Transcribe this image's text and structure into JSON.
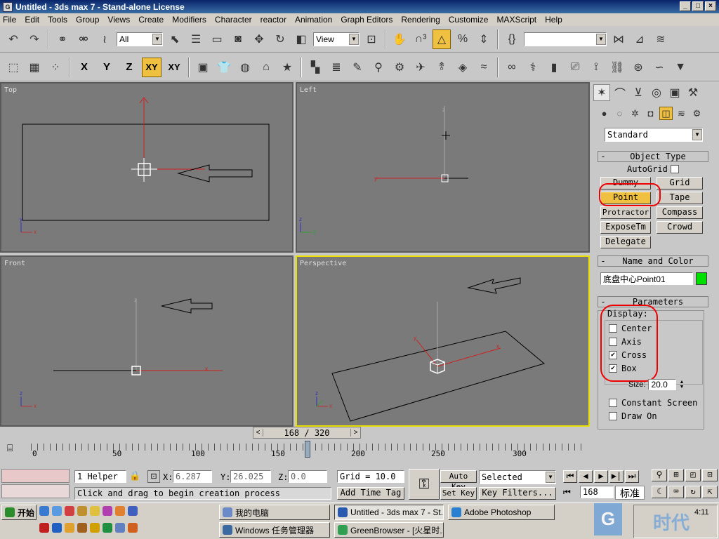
{
  "window": {
    "title": "Untitled - 3ds max 7 - Stand-alone License",
    "minimize": "_",
    "maximize": "□",
    "close": "×"
  },
  "menu": [
    "File",
    "Edit",
    "Tools",
    "Group",
    "Views",
    "Create",
    "Modifiers",
    "Character",
    "reactor",
    "Animation",
    "Graph Editors",
    "Rendering",
    "Customize",
    "MAXScript",
    "Help"
  ],
  "toolbar": {
    "selection_filter": "All",
    "ref_coord": "View",
    "named_selection": "",
    "axes": [
      "X",
      "Y",
      "Z",
      "XY",
      "XY"
    ]
  },
  "viewports": {
    "top": "Top",
    "left": "Left",
    "front": "Front",
    "perspective": "Perspective"
  },
  "command_panel": {
    "category": "Standard",
    "object_type": {
      "sign": "-",
      "title": "Object Type",
      "autogrid": "AutoGrid",
      "buttons": [
        "Dummy",
        "Grid",
        "Point",
        "Tape",
        "Protractor",
        "Compass",
        "ExposeTm",
        "Crowd",
        "Delegate"
      ]
    },
    "name_color": {
      "sign": "-",
      "title": "Name and Color",
      "name": "底盘中心Point01",
      "color": "#00e000"
    },
    "parameters": {
      "sign": "-",
      "title": "Parameters",
      "display_label": "Display:",
      "center": "Center",
      "axis": "Axis",
      "cross": "Cross",
      "box": "Box",
      "size_label": "Size:",
      "size_value": "20.0",
      "constant_screen": "Constant Screen",
      "draw_on": "Draw On"
    }
  },
  "timeline": {
    "frame": "168 / 320",
    "ticks": [
      "0",
      "50",
      "100",
      "150",
      "200",
      "250",
      "300"
    ]
  },
  "status": {
    "selection": "1 Helper",
    "x_label": "X:",
    "x": "6.287",
    "y_label": "Y:",
    "y": "26.025",
    "z_label": "Z:",
    "z": "0.0",
    "grid": "Grid = 10.0",
    "prompt": "Click and drag to begin creation process",
    "add_time_tag": "Add Time Tag",
    "auto_key": "Auto Key",
    "set_key": "Set Key",
    "selected": "Selected",
    "key_filters": "Key Filters...",
    "current_frame": "168",
    "ime": "标准"
  },
  "taskbar": {
    "start": "开始",
    "row1": [
      {
        "label": "我的电脑"
      },
      {
        "label": "Untitled - 3ds max 7 - St..."
      },
      {
        "label": "Adobe Photoshop"
      }
    ],
    "row2": [
      {
        "label": "Windows 任务管理器"
      },
      {
        "label": "GreenBrowser - [火星时..."
      }
    ],
    "clock": "4:11"
  },
  "watermark": "时代"
}
